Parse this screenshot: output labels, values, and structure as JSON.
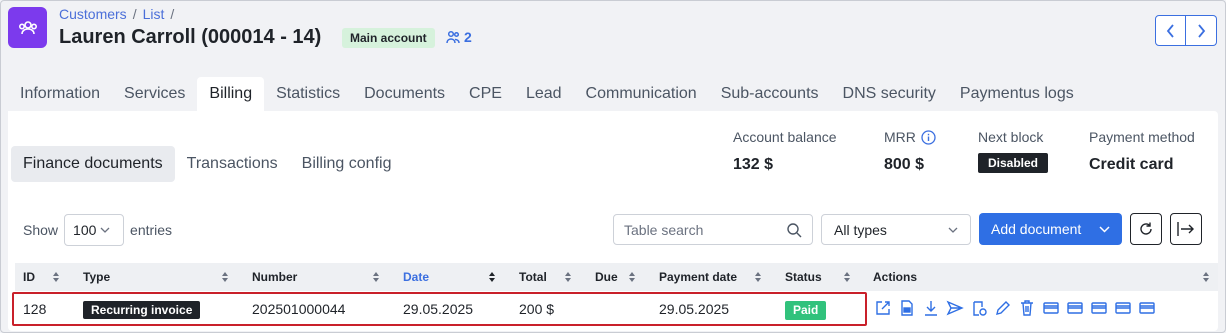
{
  "breadcrumb": {
    "item1": "Customers",
    "sep": "/",
    "item2": "List",
    "sep2": "/"
  },
  "title": "Lauren Carroll (000014 - 14)",
  "badge": "Main account",
  "sub_accounts_count": "2",
  "main_tabs": [
    "Information",
    "Services",
    "Billing",
    "Statistics",
    "Documents",
    "CPE",
    "Lead",
    "Communication",
    "Sub-accounts",
    "DNS security",
    "Paymentus logs"
  ],
  "sub_tabs": [
    "Finance documents",
    "Transactions",
    "Billing config"
  ],
  "stats": {
    "balance_label": "Account balance",
    "balance_value": "132 $",
    "mrr_label": "MRR",
    "mrr_value": "800 $",
    "next_block_label": "Next block",
    "next_block_value": "Disabled",
    "payment_label": "Payment method",
    "payment_value": "Credit card"
  },
  "controls": {
    "show": "Show",
    "page_size": "100",
    "entries": "entries",
    "search_placeholder": "Table search",
    "type_filter": "All types",
    "add_document": "Add document"
  },
  "table": {
    "headers": [
      "ID",
      "Type",
      "Number",
      "Date",
      "Total",
      "Due",
      "Payment date",
      "Status",
      "Actions"
    ],
    "rows": [
      {
        "id": "128",
        "type": "Recurring invoice",
        "number": "202501000044",
        "date": "29.05.2025",
        "total": "200 $",
        "due": "",
        "payment_date": "29.05.2025",
        "status": "Paid"
      }
    ]
  },
  "colors": {
    "accent": "#2f6fe4",
    "brand": "#7c3aed",
    "paid": "#31c27c",
    "highlight": "#c9202a"
  }
}
